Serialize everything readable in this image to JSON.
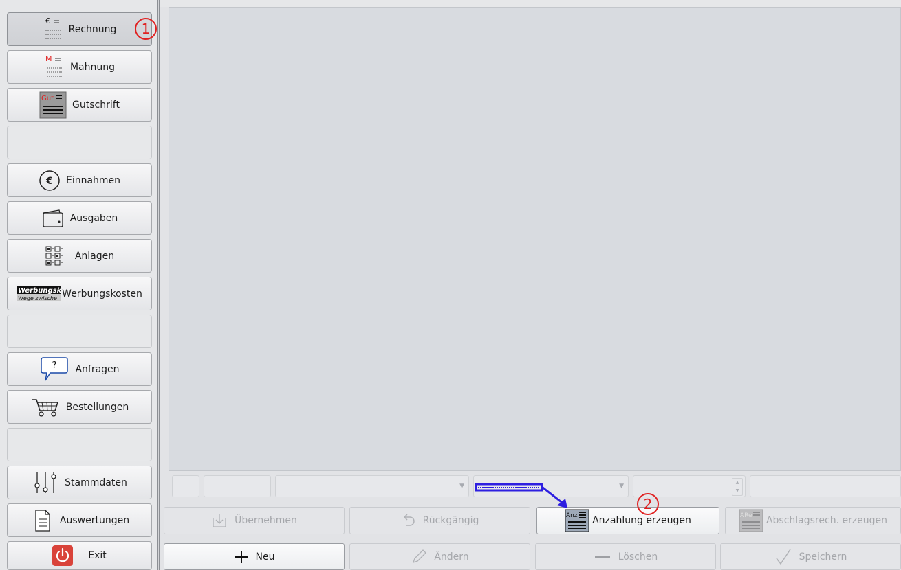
{
  "sidebar": {
    "rechnung": "Rechnung",
    "mahnung": "Mahnung",
    "gutschrift": "Gutschrift",
    "einnahmen": "Einnahmen",
    "ausgaben": "Ausgaben",
    "anlagen": "Anlagen",
    "werbungskosten": "Werbungskosten",
    "anfragen": "Anfragen",
    "bestellungen": "Bestellungen",
    "stammdaten": "Stammdaten",
    "auswertungen": "Auswertungen",
    "exit": "Exit"
  },
  "icon_text": {
    "rechnung_symbol": "€",
    "mahnung_symbol": "M",
    "gutschrift_badge": "Gut",
    "anfragen_symbol": "?",
    "werbung_line1": "Werbungsk",
    "werbung_line2": "Wege zwische",
    "anzahlung_badge": "Anz",
    "abschlag_badge": "ARe"
  },
  "actions_row1": {
    "uebernehmen": "Übernehmen",
    "rueckgaengig": "Rückgängig",
    "anzahlung": "Anzahlung erzeugen",
    "abschlag": "Abschlagsrech. erzeugen"
  },
  "actions_row2": {
    "neu": "Neu",
    "aendern": "Ändern",
    "loeschen": "Löschen",
    "speichern": "Speichern"
  },
  "annotations": {
    "marker1": "1",
    "marker2": "2"
  },
  "colors": {
    "annotation_red": "#e02020",
    "annotation_blue": "#2e1fe0",
    "exit_red": "#d9433a"
  }
}
